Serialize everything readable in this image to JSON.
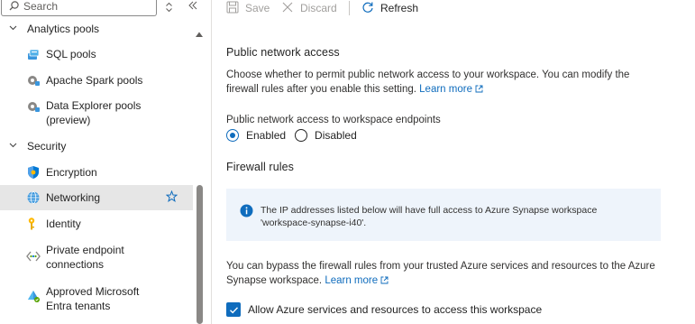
{
  "search": {
    "placeholder": "Search"
  },
  "sidebar": {
    "analytics_group": "Analytics pools",
    "analytics_items": [
      {
        "label": "SQL pools",
        "icon": "sql-pool-icon"
      },
      {
        "label": "Apache Spark pools",
        "icon": "spark-pool-icon"
      },
      {
        "label_line1": "Data Explorer pools",
        "label_line2": "(preview)",
        "icon": "data-explorer-icon"
      }
    ],
    "security_group": "Security",
    "security_items": [
      {
        "label": "Encryption",
        "icon": "shield-icon"
      },
      {
        "label": "Networking",
        "icon": "globe-icon",
        "active": true
      },
      {
        "label": "Identity",
        "icon": "key-icon"
      },
      {
        "label_line1": "Private endpoint",
        "label_line2": "connections",
        "icon": "private-endpoint-icon"
      },
      {
        "label_line1": "Approved Microsoft",
        "label_line2": "Entra tenants",
        "icon": "entra-tenant-icon"
      }
    ]
  },
  "toolbar": {
    "save_label": "Save",
    "discard_label": "Discard",
    "refresh_label": "Refresh"
  },
  "main": {
    "public_access_heading": "Public network access",
    "public_access_desc": "Choose whether to permit public network access to your workspace. You can modify the firewall rules after you enable this setting.",
    "learn_more": "Learn more",
    "endpoints_label": "Public network access to workspace endpoints",
    "radio_enabled": "Enabled",
    "radio_disabled": "Disabled",
    "selected": "Enabled",
    "firewall_heading": "Firewall rules",
    "info_text": "The IP addresses listed below will have full access to Azure Synapse workspace 'workspace-synapse-i40'.",
    "bypass_text": "You can bypass the firewall rules from your trusted Azure services and resources to the Azure Synapse workspace.",
    "allow_azure_label": "Allow Azure services and resources to access this workspace",
    "allow_azure_checked": true
  },
  "colors": {
    "accent": "#0f6cbd",
    "active_bg": "#e6e6e6",
    "info_bg": "#eef4fb"
  }
}
